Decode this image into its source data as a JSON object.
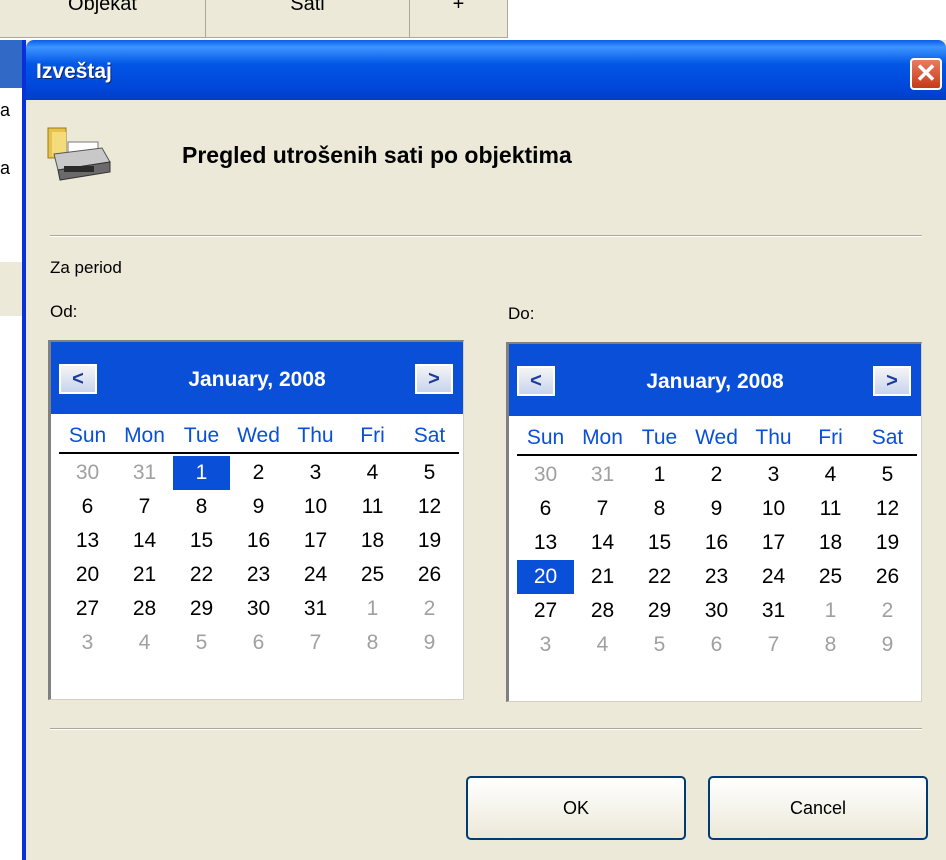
{
  "background": {
    "columns": [
      "Objekat",
      "Sati",
      "+"
    ],
    "left_labels": [
      "a",
      "a"
    ]
  },
  "dialog": {
    "title": "Izveštaj",
    "close_symbol": "✕",
    "header_title": "Pregled utrošenih sati po objektima",
    "period_label": "Za period",
    "from_label": "Od:",
    "to_label": "Do:",
    "ok_label": "OK",
    "cancel_label": "Cancel",
    "icon": "printer-folder-icon"
  },
  "calendars": {
    "from": {
      "month": "January, 2008",
      "prev_symbol": "<",
      "next_symbol": ">",
      "day_names": [
        "Sun",
        "Mon",
        "Tue",
        "Wed",
        "Thu",
        "Fri",
        "Sat"
      ],
      "weeks": [
        [
          "30",
          "31",
          "1",
          "2",
          "3",
          "4",
          "5"
        ],
        [
          "6",
          "7",
          "8",
          "9",
          "10",
          "11",
          "12"
        ],
        [
          "13",
          "14",
          "15",
          "16",
          "17",
          "18",
          "19"
        ],
        [
          "20",
          "21",
          "22",
          "23",
          "24",
          "25",
          "26"
        ],
        [
          "27",
          "28",
          "29",
          "30",
          "31",
          "1",
          "2"
        ],
        [
          "3",
          "4",
          "5",
          "6",
          "7",
          "8",
          "9"
        ]
      ],
      "selected_day": "1"
    },
    "to": {
      "month": "January, 2008",
      "prev_symbol": "<",
      "next_symbol": ">",
      "day_names": [
        "Sun",
        "Mon",
        "Tue",
        "Wed",
        "Thu",
        "Fri",
        "Sat"
      ],
      "weeks": [
        [
          "30",
          "31",
          "1",
          "2",
          "3",
          "4",
          "5"
        ],
        [
          "6",
          "7",
          "8",
          "9",
          "10",
          "11",
          "12"
        ],
        [
          "13",
          "14",
          "15",
          "16",
          "17",
          "18",
          "19"
        ],
        [
          "20",
          "21",
          "22",
          "23",
          "24",
          "25",
          "26"
        ],
        [
          "27",
          "28",
          "29",
          "30",
          "31",
          "1",
          "2"
        ],
        [
          "3",
          "4",
          "5",
          "6",
          "7",
          "8",
          "9"
        ]
      ],
      "selected_day": "20"
    }
  },
  "colors": {
    "titlebar": "#0054e3",
    "calendar_accent": "#0a4fd8",
    "dialog_bg": "#ece9d8"
  }
}
